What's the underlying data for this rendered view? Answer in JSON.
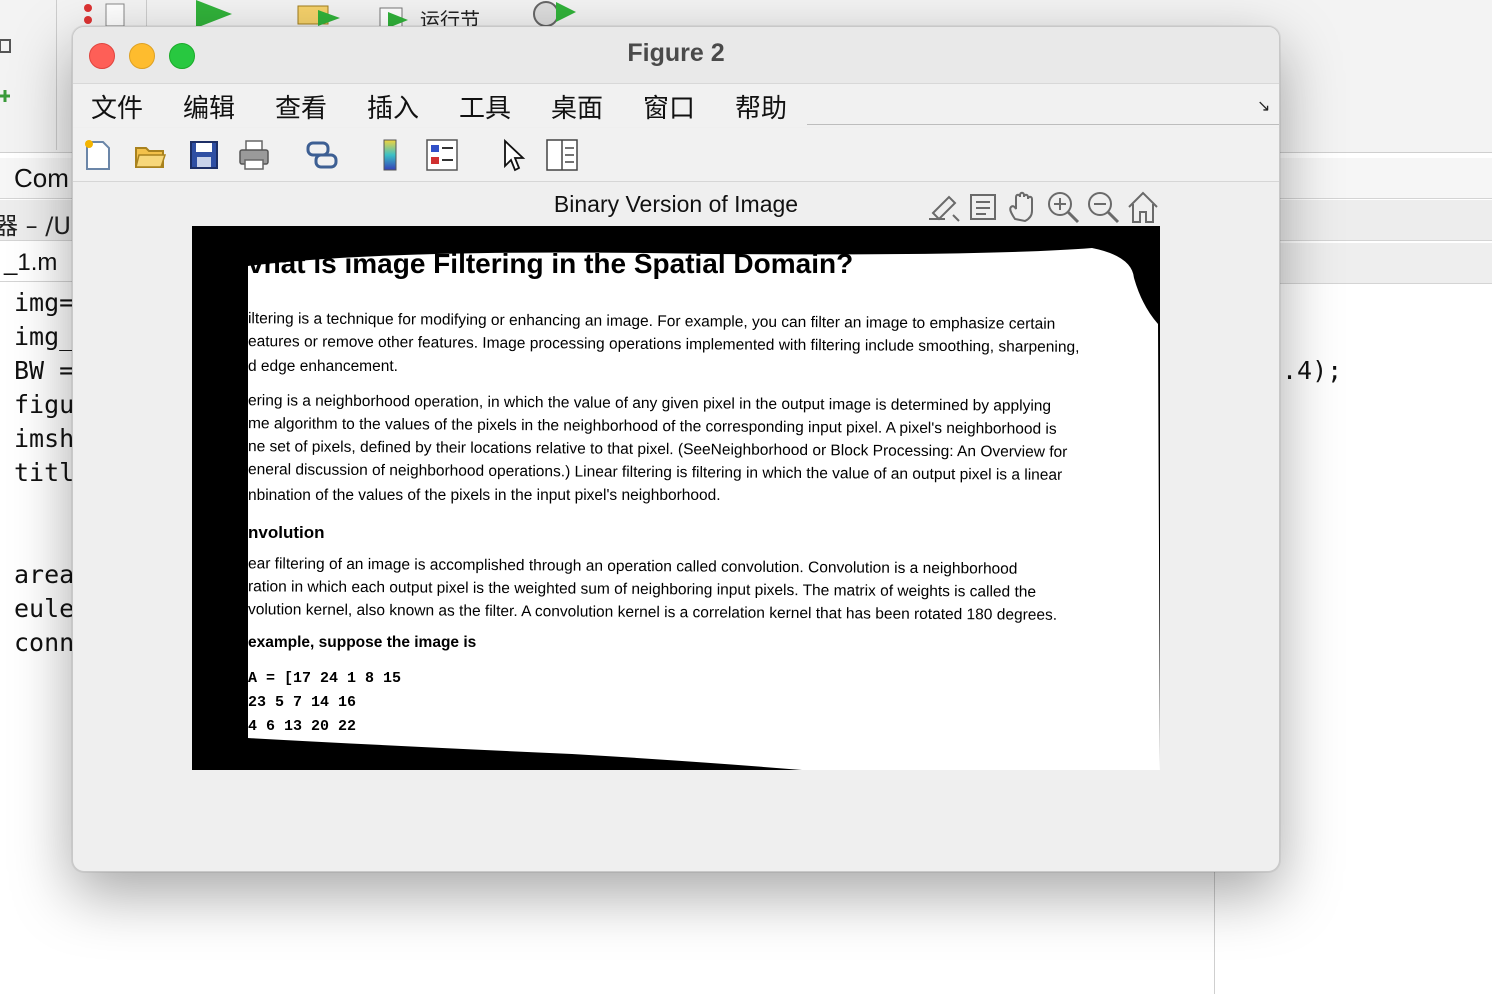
{
  "background": {
    "toolstrip": {
      "run_section_label": "运行节"
    },
    "command_window_label": "Com",
    "path_label": "器 – /U",
    "file_tab_label": "_1.m",
    "code_lines": [
      "img=",
      "img_",
      "BW =",
      "figu",
      "imsh",
      "titl",
      "",
      "",
      "area",
      "eule",
      "conn"
    ],
    "code_fragment_right": ".4);"
  },
  "figure": {
    "title": "Figure 2",
    "menu": [
      "文件",
      "编辑",
      "查看",
      "插入",
      "工具",
      "桌面",
      "窗口",
      "帮助"
    ],
    "toolbar_icons": [
      "new-figure-icon",
      "open-file-icon",
      "save-icon",
      "print-icon",
      "link-plot-icon",
      "colorbar-icon",
      "legend-icon",
      "edit-plot-arrow-icon",
      "property-inspector-icon"
    ],
    "axes_title": "Binary Version of Image",
    "axes_toolbar_icons": [
      "brush-icon",
      "data-tips-icon",
      "pan-hand-icon",
      "zoom-in-icon",
      "zoom-out-icon",
      "restore-view-home-icon"
    ],
    "image": {
      "heading": "vnat is image Filtering in the Spatial Domain?",
      "p1": [
        "iltering is a technique for modifying or enhancing an image. For example, you can filter an image to emphasize certain",
        "eatures or remove other features. Image processing operations implemented with filtering include smoothing, sharpening,",
        "d edge enhancement."
      ],
      "p2": [
        "ering is a neighborhood operation, in which the value of any given pixel in the output image is determined by applying",
        "me algorithm to the values of the pixels in the neighborhood of the corresponding input pixel. A pixel's neighborhood is",
        "ne set of pixels, defined by their locations relative to that pixel. (SeeNeighborhood or Block Processing: An Overview for",
        "eneral discussion of neighborhood operations.) Linear filtering is filtering in which the value of an output pixel is a linear",
        "nbination of the values of the pixels in the input pixel's neighborhood."
      ],
      "subheading": "nvolution",
      "p3": [
        "ear filtering of an image is accomplished through an operation called convolution. Convolution is a neighborhood",
        "ration in which each output pixel is the weighted sum of neighboring input pixels. The matrix of weights is called the",
        "volution kernel, also known as the filter. A convolution kernel is a correlation kernel that has been rotated 180 degrees."
      ],
      "p4": "example, suppose the image is",
      "matrix": [
        "A = [17   24    1    8   15",
        "     23    5    7   14   16",
        "      4    6   13   20   22"
      ]
    }
  }
}
